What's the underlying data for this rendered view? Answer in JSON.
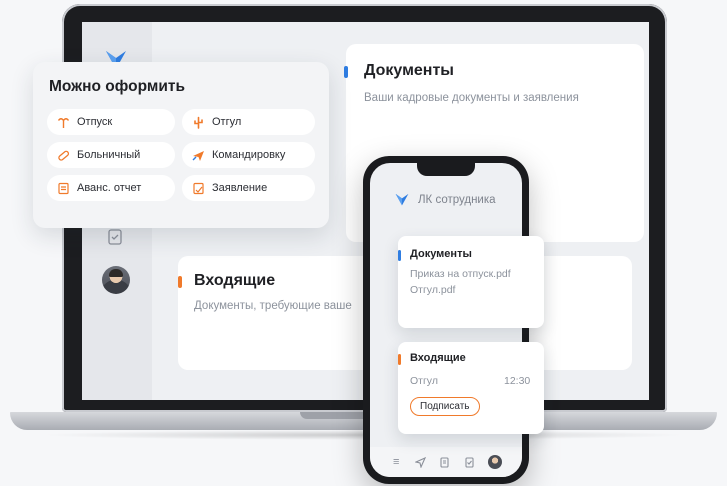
{
  "laptop": {
    "documents": {
      "title": "Документы",
      "subtitle": "Ваши кадровые документы и заявления"
    },
    "inbox": {
      "title": "Входящие",
      "subtitle": "Документы, требующие ваше"
    }
  },
  "panel": {
    "title": "Можно оформить",
    "chips": [
      {
        "label": "Отпуск",
        "icon": "palm-tree-icon"
      },
      {
        "label": "Отгул",
        "icon": "cactus-icon"
      },
      {
        "label": "Больничный",
        "icon": "pill-icon"
      },
      {
        "label": "Командировку",
        "icon": "plane-icon"
      },
      {
        "label": "Аванс. отчет",
        "icon": "report-icon"
      },
      {
        "label": "Заявление",
        "icon": "signed-doc-icon"
      }
    ]
  },
  "phone": {
    "header_title": "ЛК сотрудника",
    "documents": {
      "title": "Документы",
      "files": [
        "Приказ на отпуск.pdf",
        "Отгул.pdf"
      ]
    },
    "inbox": {
      "title": "Входящие",
      "item": "Отгул",
      "time": "12:30",
      "sign_label": "Подписать"
    }
  },
  "colors": {
    "accent_blue": "#2f7de1",
    "accent_orange": "#f07a2b"
  }
}
